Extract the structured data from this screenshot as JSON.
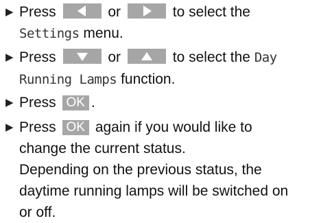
{
  "steps": [
    {
      "a": "Press",
      "or": "or",
      "b": "to select the",
      "menu": "Settings",
      "c": "menu.",
      "keys": [
        "left-arrow-key",
        "right-arrow-key"
      ]
    },
    {
      "a": "Press",
      "or": "or",
      "b": "to select the",
      "fn1": "Day",
      "fn2": "Running Lamps",
      "c": "function.",
      "keys": [
        "down-arrow-key",
        "up-arrow-key"
      ]
    },
    {
      "a": "Press",
      "key": "OK",
      "c": "."
    },
    {
      "a": "Press",
      "key": "OK",
      "b": "again if you would like to",
      "l2": "change the current status.",
      "l3": "Depending on the previous status, the",
      "l4": "daytime running lamps will be switched on",
      "l5": "or off."
    }
  ],
  "colors": {
    "key_bg": "#a6a6a6",
    "key_glyph": "#ffffff"
  }
}
